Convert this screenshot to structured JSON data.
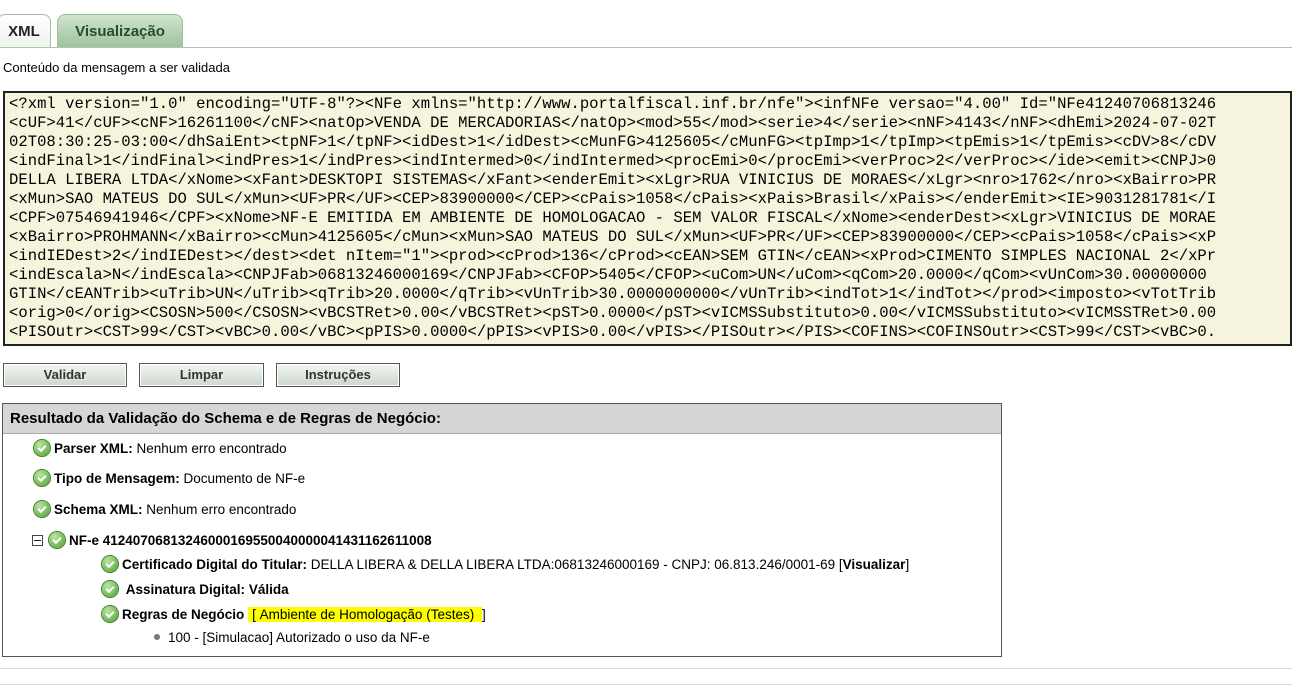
{
  "tabs": [
    {
      "label": "XML"
    },
    {
      "label": "Visualização"
    }
  ],
  "caption": "Conteúdo da mensagem a ser validada",
  "xml_lines": [
    "<?xml version=\"1.0\" encoding=\"UTF-8\"?><NFe xmlns=\"http://www.portalfiscal.inf.br/nfe\"><infNFe versao=\"4.00\" Id=\"NFe41240706813246",
    "<cUF>41</cUF><cNF>16261100</cNF><natOp>VENDA DE MERCADORIAS</natOp><mod>55</mod><serie>4</serie><nNF>4143</nNF><dhEmi>2024-07-02T",
    "02T08:30:25-03:00</dhSaiEnt><tpNF>1</tpNF><idDest>1</idDest><cMunFG>4125605</cMunFG><tpImp>1</tpImp><tpEmis>1</tpEmis><cDV>8</cDV",
    "<indFinal>1</indFinal><indPres>1</indPres><indIntermed>0</indIntermed><procEmi>0</procEmi><verProc>2</verProc></ide><emit><CNPJ>0",
    "DELLA LIBERA LTDA</xNome><xFant>DESKTOPI SISTEMAS</xFant><enderEmit><xLgr>RUA VINICIUS DE MORAES</xLgr><nro>1762</nro><xBairro>PR",
    "<xMun>SAO MATEUS DO SUL</xMun><UF>PR</UF><CEP>83900000</CEP><cPais>1058</cPais><xPais>Brasil</xPais></enderEmit><IE>9031281781</I",
    "<CPF>07546941946</CPF><xNome>NF-E EMITIDA EM AMBIENTE DE HOMOLOGACAO - SEM VALOR FISCAL</xNome><enderDest><xLgr>VINICIUS DE MORAE",
    "<xBairro>PROHMANN</xBairro><cMun>4125605</cMun><xMun>SAO MATEUS DO SUL</xMun><UF>PR</UF><CEP>83900000</CEP><cPais>1058</cPais><xP",
    "<indIEDest>2</indIEDest></dest><det nItem=\"1\"><prod><cProd>136</cProd><cEAN>SEM GTIN</cEAN><xProd>CIMENTO SIMPLES NACIONAL 2</xPr",
    "<indEscala>N</indEscala><CNPJFab>06813246000169</CNPJFab><CFOP>5405</CFOP><uCom>UN</uCom><qCom>20.0000</qCom><vUnCom>30.00000000",
    "GTIN</cEANTrib><uTrib>UN</uTrib><qTrib>20.0000</qTrib><vUnTrib>30.0000000000</vUnTrib><indTot>1</indTot></prod><imposto><vTotTrib",
    "<orig>0</orig><CSOSN>500</CSOSN><vBCSTRet>0.00</vBCSTRet><pST>0.0000</pST><vICMSSubstituto>0.00</vICMSSubstituto><vICMSSTRet>0.00",
    "<PISOutr><CST>99</CST><vBC>0.00</vBC><pPIS>0.0000</pPIS><vPIS>0.00</vPIS></PISOutr></PIS><COFINS><COFINSOutr><CST>99</CST><vBC>0."
  ],
  "buttons": {
    "validar": "Validar",
    "limpar": "Limpar",
    "instrucoes": "Instruções"
  },
  "result": {
    "title": "Resultado da Validação do Schema e de Regras de Negócio:",
    "parser_label": "Parser XML:",
    "parser_value": "Nenhum erro encontrado",
    "tipo_label": "Tipo de Mensagem:",
    "tipo_value": "Documento de NF-e",
    "schema_label": "Schema XML:",
    "schema_value": "Nenhum erro encontrado",
    "nfe_key": "NF-e 41240706813246000169550040000041431162611008",
    "cert_label": "Certificado Digital do Titular:",
    "cert_value": "DELLA LIBERA & DELLA LIBERA LTDA:06813246000169 - CNPJ: 06.813.246/0001-69 [",
    "cert_link": "Visualizar",
    "cert_close": "]",
    "assinatura_label": "Assinatura Digital:",
    "assinatura_value": "Válida",
    "regras_label": "Regras de Negócio",
    "regras_open": "[",
    "regras_env": "Ambiente de Homologação (Testes)",
    "regras_close": "]",
    "status_msg": "100 - [Simulacao] Autorizado o uso da NF-e"
  }
}
